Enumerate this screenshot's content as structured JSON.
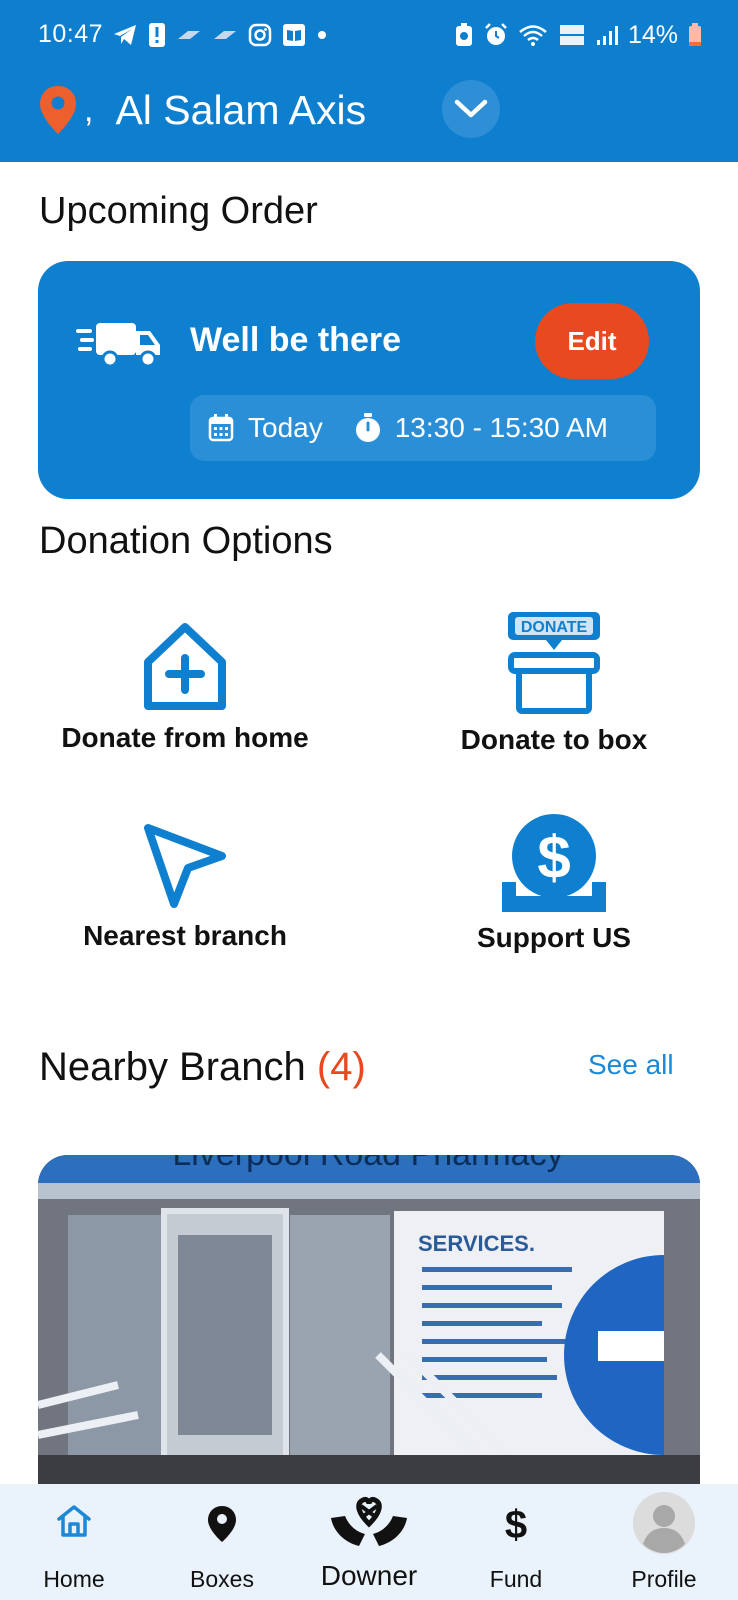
{
  "status_bar": {
    "time": "10:47",
    "battery": "14%"
  },
  "header": {
    "comma": ",",
    "location": "Al Salam Axis"
  },
  "upcoming": {
    "title": "Upcoming Order",
    "message": "Well be there",
    "edit_label": "Edit",
    "day": "Today",
    "time_range": "13:30 - 15:30 AM"
  },
  "donation": {
    "title": "Donation Options",
    "options": [
      {
        "label": "Donate from home",
        "icon": "house-plus-icon"
      },
      {
        "label": "Donate to box",
        "icon": "donate-box-icon",
        "badge": "DONATE"
      },
      {
        "label": "Nearest branch",
        "icon": "navigation-arrow-icon"
      },
      {
        "label": "Support US",
        "icon": "coin-dollar-icon"
      }
    ]
  },
  "nearby": {
    "title": "Nearby Branch",
    "count": "(4)",
    "see_all": "See all",
    "photo_sign": "Liverpool Road Pharmacy",
    "photo_panel": "SERVICES."
  },
  "nav": {
    "items": [
      {
        "label": "Home",
        "icon": "home-icon"
      },
      {
        "label": "Boxes",
        "icon": "map-pin-icon"
      },
      {
        "label": "Downer",
        "icon": "heart-hands-icon"
      },
      {
        "label": "Fund",
        "icon": "dollar-icon"
      },
      {
        "label": "Profile",
        "icon": "avatar-icon"
      }
    ]
  },
  "colors": {
    "primary": "#0e7fcf",
    "accent": "#e8491e",
    "nav_bg": "#eaf2fb"
  }
}
